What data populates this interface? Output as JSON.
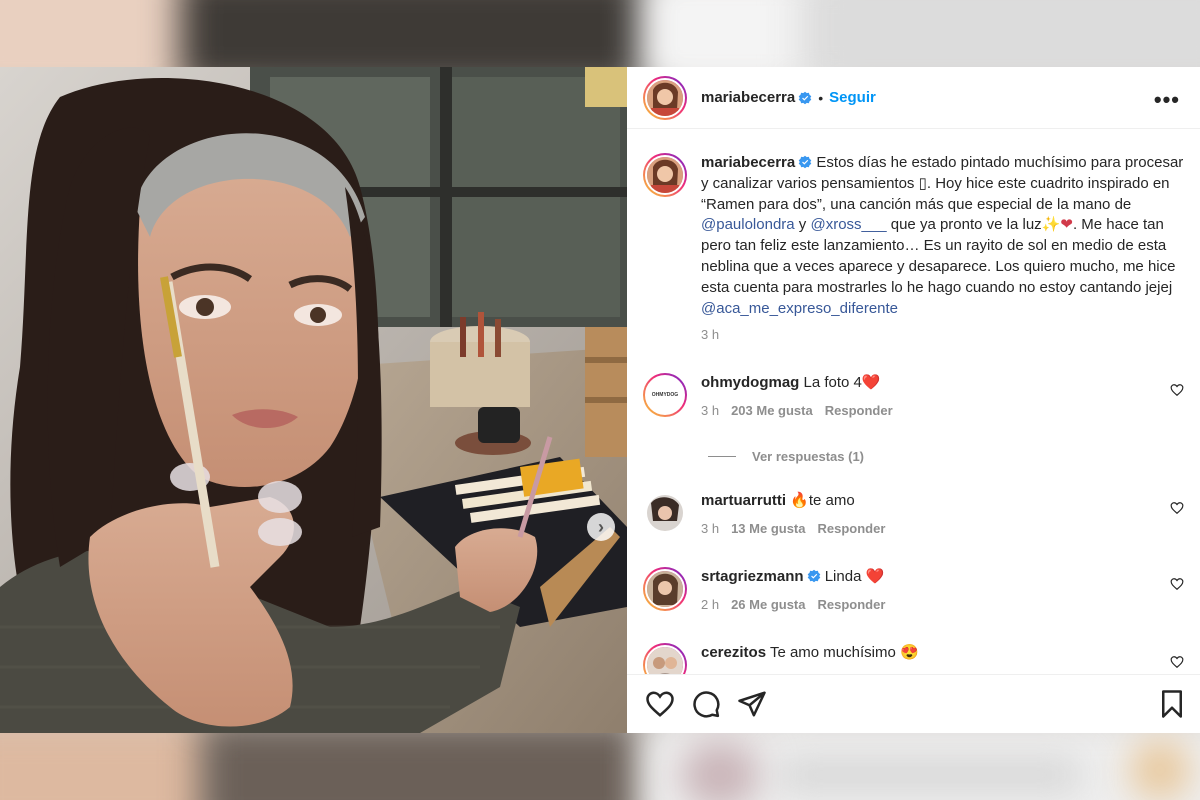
{
  "post": {
    "author": "mariabecerra",
    "follow_label": "Seguir",
    "separator": "•",
    "more_label": "•••"
  },
  "caption": {
    "username": "mariabecerra",
    "text_1": "Estos días he estado pintado muchísimo para procesar y canalizar varios pensamientos ",
    "glyph": "▯",
    "text_2": ". Hoy hice este cuadrito inspirado en “Ramen para dos”, una canción más que especial de la mano de ",
    "mention_1": "@paulolondra",
    "text_3": " y ",
    "mention_2": "@xross___",
    "text_4": " que ya pronto ve la luz",
    "emoji_1": "✨",
    "emoji_2": "❤",
    "text_5": ". Me hace tan pero tan feliz este lanzamiento… Es un rayito de sol en medio de esta neblina que a veces aparece y desaparece. Los quiero mucho, me hice esta cuenta para mostrarles lo he hago cuando no estoy cantando jejej ",
    "mention_3": "@aca_me_expreso_diferente",
    "time": "3 h"
  },
  "comments": [
    {
      "username": "ohmydogmag",
      "text": "La foto 4",
      "emoji": "❤️",
      "time": "3 h",
      "likes": "203 Me gusta",
      "reply": "Responder",
      "avatar_text": "OHMYDOG"
    },
    {
      "username": "martuarrutti",
      "emoji": "🔥",
      "text": "te amo",
      "time": "3 h",
      "likes": "13 Me gusta",
      "reply": "Responder"
    },
    {
      "username": "srtagriezmann",
      "text": "Linda",
      "emoji": "❤️",
      "time": "2 h",
      "likes": "26 Me gusta",
      "reply": "Responder"
    },
    {
      "username": "cerezitos",
      "text": "Te amo muchísimo",
      "emoji": "😍"
    }
  ],
  "view_replies": "Ver respuestas (1)",
  "colors": {
    "accent": "#0095f6",
    "text": "#262626",
    "muted": "#8e8e8e",
    "heart": "#ed4956"
  }
}
